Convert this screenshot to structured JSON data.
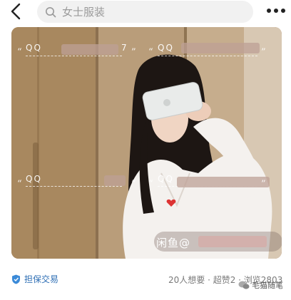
{
  "header": {
    "search_placeholder": "女士服装"
  },
  "icons": {
    "back": "chevron-left-icon",
    "search": "search-icon",
    "more": "more-dots-icon",
    "guarantee": "shield-icon",
    "logo": "wechat-logo-icon"
  },
  "photo": {
    "watermarks": [
      {
        "label": "QQ",
        "suffix": "7"
      },
      {
        "label": "QQ",
        "suffix": ""
      },
      {
        "label": "QQ",
        "suffix": ""
      },
      {
        "label": "QQ",
        "suffix": ""
      }
    ],
    "tag_text": "闲鱼@"
  },
  "footer": {
    "guarantee_label": "担保交易",
    "stats_text": "20人想要 · 超赞2 · 浏览2803",
    "logo_text": "毛猫随笔"
  },
  "colors": {
    "guarantee_accent": "#2f6fb5",
    "stats_gray": "#7a7a7a"
  }
}
